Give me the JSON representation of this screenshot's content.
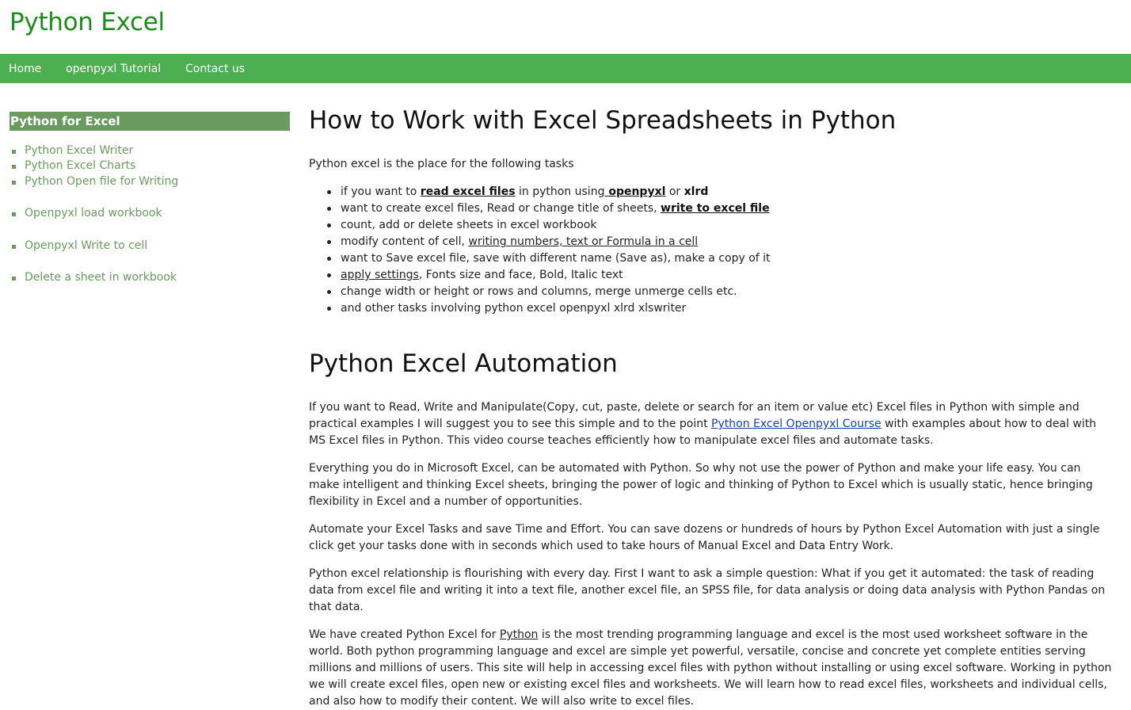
{
  "site": {
    "title": "Python Excel"
  },
  "nav": {
    "items": [
      "Home",
      "openpyxl Tutorial",
      "Contact us"
    ]
  },
  "sidebar": {
    "heading": "Python for Excel",
    "items": [
      "Python Excel Writer",
      "Python Excel Charts",
      "Python Open file for Writing",
      "Openpyxl load workbook",
      "Openpyxl Write to cell",
      "Delete a sheet in workbook"
    ]
  },
  "main": {
    "h1": "How to Work with Excel Spreadsheets in Python",
    "intro": "Python excel is the place for the following tasks",
    "tasks": {
      "t0a": "if you want to ",
      "t0link1": "read excel files",
      "t0b": " in python using",
      "t0link2": " openpyxl",
      "t0c": " or ",
      "t0d": "xlrd",
      "t1a": "want to create excel files, Read or change title of sheets, ",
      "t1link": "write to excel file",
      "t2": "count, add or delete sheets in excel workbook",
      "t3a": "modify content of cell, ",
      "t3link": "writing numbers, text or Formula in a cell",
      "t4": "want to Save excel file, save with different name (Save as), make a copy of it",
      "t5link": "apply settings",
      "t5b": ", Fonts size and face, Bold, Italic text",
      "t6": "change width or height or rows and columns, merge unmerge cells etc.",
      "t7": "and other tasks involving python excel openpyxl xlrd xlswriter"
    },
    "h2": "Python Excel Automation",
    "p1a": "If you want to Read, Write and Manipulate(Copy, cut, paste, delete or search for an item or value etc) Excel files in Python with simple and practical examples I will suggest you to see this simple and to the point ",
    "p1link": "Python Excel Openpyxl Course",
    "p1b": " with examples about how to deal with MS Excel files in Python. This video course teaches efficiently how to manipulate excel files and automate tasks.",
    "p2": "Everything you do in Microsoft Excel, can be automated with Python. So why not use the power of Python and make your life easy. You can make intelligent and thinking Excel sheets, bringing the power of logic and thinking of Python to Excel which is usually static, hence bringing flexibility in Excel and a number of opportunities.",
    "p3": "Automate your Excel Tasks and save Time and Effort. You can save dozens or hundreds of hours by Python Excel Automation with just a single click get your tasks done with in seconds which used to take hours of Manual Excel and Data Entry Work.",
    "p4": "Python excel relationship is flourishing with every day. First I want to ask a simple question: What if you get it automated: the task of reading data from excel file and writing it into a text file, another excel file, an SPSS file,  for data analysis or doing data analysis with Python Pandas on that data.",
    "p5a": "We have created Python Excel for ",
    "p5link": "Python",
    "p5b": " is the most trending programming language and excel is the most used worksheet software in the world.  Both python programming language and excel are simple yet powerful, versatile, concise and concrete yet complete entities serving millions and millions of users. This site will help in accessing excel files with python without installing or using excel software. Working in python we will create excel files, open new or existing excel files and worksheets. We will learn how to read excel files, worksheets and individual cells, and also how to modify their content. We will also write to excel files."
  }
}
